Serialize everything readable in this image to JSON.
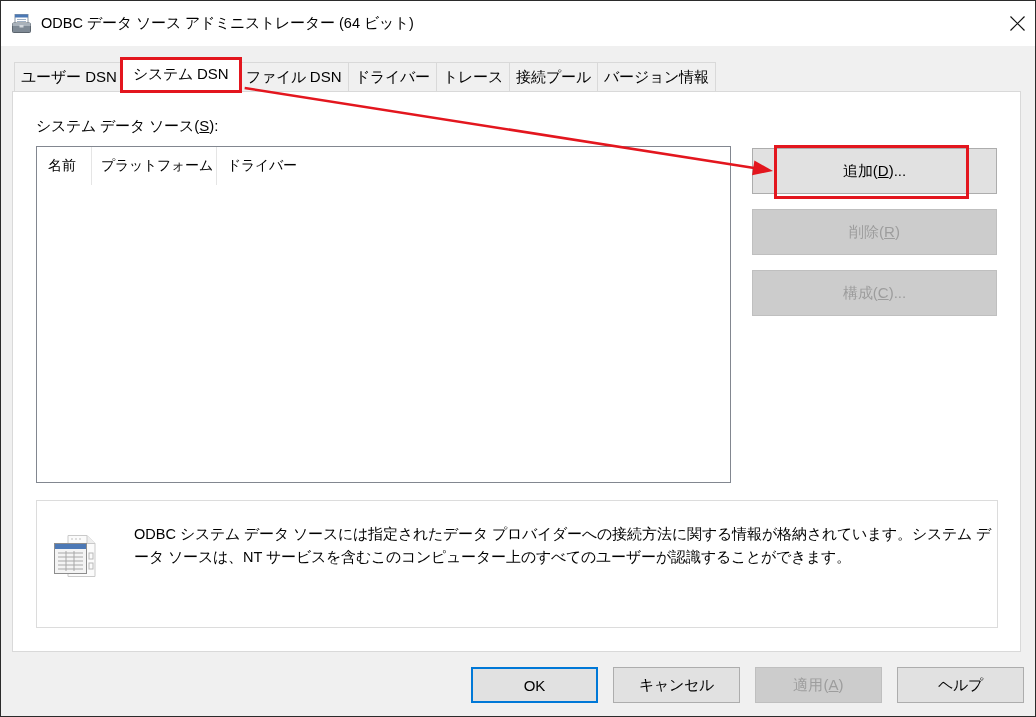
{
  "window": {
    "title": "ODBC データ ソース アドミニストレーター (64 ビット)"
  },
  "tabs": [
    {
      "label": "ユーザー DSN",
      "selected": false,
      "highlighted": false
    },
    {
      "label": "システム DSN",
      "selected": true,
      "highlighted": true
    },
    {
      "label": "ファイル DSN",
      "selected": false,
      "highlighted": false
    },
    {
      "label": "ドライバー",
      "selected": false,
      "highlighted": false
    },
    {
      "label": "トレース",
      "selected": false,
      "highlighted": false
    },
    {
      "label": "接続プール",
      "selected": false,
      "highlighted": false
    },
    {
      "label": "バージョン情報",
      "selected": false,
      "highlighted": false
    }
  ],
  "data_sources": {
    "label": {
      "text_before": "システム データ ソース(",
      "access_key": "S",
      "text_after": "):"
    },
    "columns": [
      "名前",
      "プラットフォーム",
      "ドライバー"
    ]
  },
  "actions": [
    {
      "text_before": "追加(",
      "access_key": "D",
      "text_after": ")...",
      "disabled": false,
      "highlighted": true
    },
    {
      "text_before": "削除(",
      "access_key": "R",
      "text_after": ")",
      "disabled": true,
      "highlighted": false
    },
    {
      "text_before": "構成(",
      "access_key": "C",
      "text_after": ")...",
      "disabled": true,
      "highlighted": false
    }
  ],
  "description": "ODBC システム データ ソースには指定されたデータ プロバイダーへの接続方法に関する情報が格納されています。システム データ ソースは、NT サービスを含むこのコンピューター上のすべてのユーザーが認識することができます。",
  "annotation_arrow": true,
  "buttons": [
    {
      "label": "OK",
      "default": true,
      "disabled": false
    },
    {
      "label": "キャンセル",
      "default": false,
      "disabled": false
    },
    {
      "text_before": "適用(",
      "access_key": "A",
      "text_after": ")",
      "default": false,
      "disabled": true
    },
    {
      "label": "ヘルプ",
      "default": false,
      "disabled": false
    }
  ]
}
